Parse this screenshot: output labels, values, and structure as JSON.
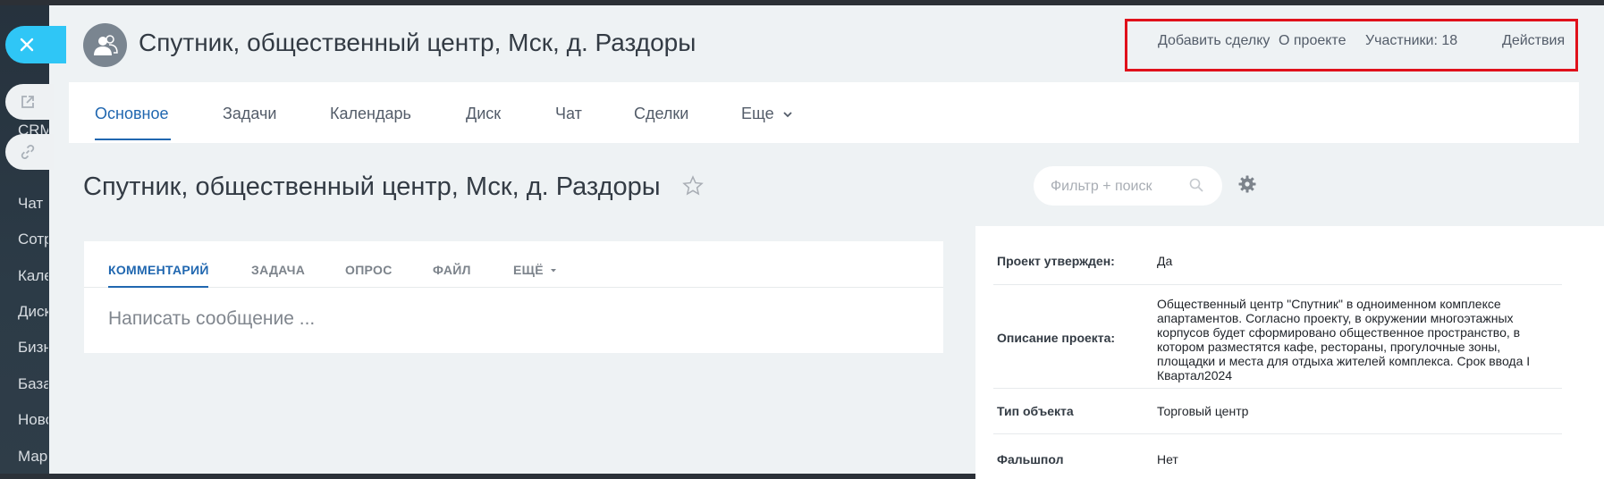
{
  "sidebar": {
    "items": [
      "CRM",
      "Чат",
      "Сотрудники",
      "Календарь",
      "Диск",
      "Бизнес",
      "База",
      "Новости",
      "Маркет"
    ]
  },
  "slider": {
    "close_icon": "close-icon",
    "open_icon": "external-link-icon",
    "link_icon": "link-icon"
  },
  "header": {
    "title": "Спутник, общественный центр, Мск, д. Раздоры",
    "actions": {
      "add_deal": "Добавить сделку",
      "about": "О проекте",
      "members": "Участники: 18",
      "actions": "Действия"
    },
    "highlight_color": "#e0111b"
  },
  "tabs": [
    "Основное",
    "Задачи",
    "Календарь",
    "Диск",
    "Чат",
    "Сделки",
    "Еще"
  ],
  "content": {
    "title": "Спутник, общественный центр, Мск, д. Раздоры",
    "search_placeholder": "Фильтр + поиск"
  },
  "feed": {
    "tabs": [
      "КОММЕНТАРИЙ",
      "ЗАДАЧА",
      "ОПРОС",
      "ФАЙЛ",
      "ЕЩЁ"
    ],
    "placeholder": "Написать сообщение ..."
  },
  "info": {
    "rows": [
      {
        "label": "Проект утвержден:",
        "value": "Да"
      },
      {
        "label": "Описание проекта:",
        "value": "Общественный центр \"Спутник\" в одноименном комплексе апартаментов. Согласно проекту, в окружении многоэтажных корпусов будет сформировано общественное пространство, в котором разместятся кафе, рестораны, прогулочные зоны, площадки и места для отдыха жителей комплекса. Срок ввода I Квартал2024"
      },
      {
        "label": "Тип объекта",
        "value": "Торговый центр"
      },
      {
        "label": "Фальшпол",
        "value": "Нет"
      }
    ]
  },
  "colors": {
    "accent": "#2067b0",
    "close_button": "#2fc6f6",
    "panel_bg": "#eef2f4"
  }
}
